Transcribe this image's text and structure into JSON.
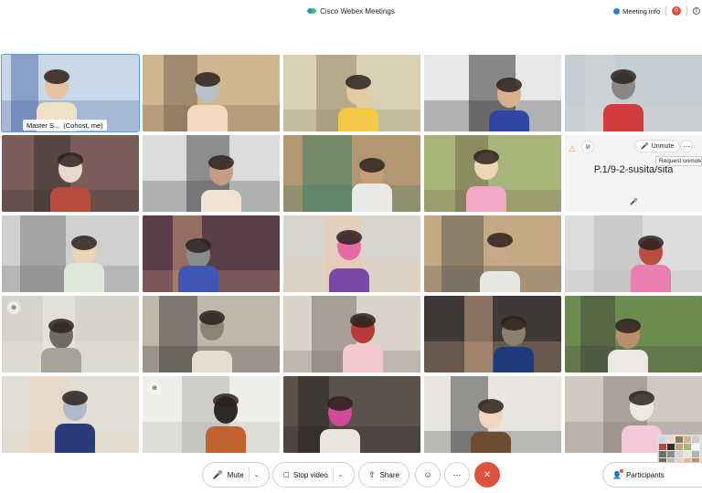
{
  "titlebar": {
    "app_title": "Cisco Webex Meetings",
    "meeting_info_label": "Meeting info",
    "notification_count": "0"
  },
  "tiles": [
    {
      "name": "Master S...",
      "role": "(Cohost, me)",
      "colors": [
        "#c9d8e6",
        "#f0e2c8",
        "#3b5aa0",
        "#e7c3a2"
      ]
    },
    {
      "colors": [
        "#cdb690",
        "#f4d9bf",
        "#6b5740",
        "#b7c1c7"
      ]
    },
    {
      "colors": [
        "#d9d0b4",
        "#f3c844",
        "#8c7a5a",
        "#e8c9a6"
      ]
    },
    {
      "colors": [
        "#e7e7e7",
        "#2f46a7",
        "#111111",
        "#d9b08c"
      ]
    },
    {
      "colors": [
        "#c4cdd2",
        "#d23c3c",
        "#d8d8d8",
        "#888888"
      ]
    },
    {
      "colors": [
        "#7a5d59",
        "#b84b3e",
        "#2b2b2b",
        "#e7d8cc"
      ]
    },
    {
      "colors": [
        "#d9dcd9",
        "#f1e2d4",
        "#2f2f2f",
        "#c49d86"
      ]
    },
    {
      "colors": [
        "#b39770",
        "#e9e8e4",
        "#2a7a63",
        "#c4a079"
      ]
    },
    {
      "colors": [
        "#a7b47a",
        "#f1a8c4",
        "#6e5a43",
        "#f0d6b9"
      ]
    },
    {
      "video_off": true,
      "unmute_label": "Unmute",
      "center_name": "P.1/9-2-susita/sita"
    },
    {
      "colors": [
        "#cfcfcf",
        "#dfe8d8",
        "#6d6d6d",
        "#e9d3b9"
      ]
    },
    {
      "colors": [
        "#5a3e4a",
        "#3f56b2",
        "#e1a77f",
        "#8c8d8b"
      ]
    },
    {
      "colors": [
        "#d8d5cf",
        "#7b4aa8",
        "#f0c8a8",
        "#e86aa2"
      ]
    },
    {
      "colors": [
        "#c3a883",
        "#e8e6e2",
        "#4c4c4c",
        "#c9a88b"
      ]
    },
    {
      "colors": [
        "#dcdcdc",
        "#e97fb0",
        "#b2b4b4",
        "#b84d40"
      ]
    },
    {
      "colors": [
        "#d7d3cd",
        "#a8a39a",
        "#f1efea",
        "#6f6a64"
      ],
      "badge": "⊕"
    },
    {
      "colors": [
        "#bfb8a9",
        "#e4ded1",
        "#2f2d2b",
        "#8b8376"
      ]
    },
    {
      "colors": [
        "#d9d3c8",
        "#f3c9cf",
        "#6a6058",
        "#b93a3a"
      ]
    },
    {
      "colors": [
        "#3f3a38",
        "#1f3a7a",
        "#e5b895",
        "#8d7f6e"
      ]
    },
    {
      "colors": [
        "#6c8d4f",
        "#ece9e4",
        "#3a3a3a",
        "#b98f6c"
      ]
    },
    {
      "colors": [
        "#e1ded7",
        "#2a3a7a",
        "#f0d2b8",
        "#b0b9c7"
      ]
    },
    {
      "colors": [
        "#efeeea",
        "#c1612d",
        "#a9a7a3",
        "#2a2a2a"
      ],
      "badge": "⊕"
    },
    {
      "colors": [
        "#5b524c",
        "#e9e5de",
        "#1d1b1a",
        "#d04a9b"
      ]
    },
    {
      "colors": [
        "#e9e6e1",
        "#6d4c2f",
        "#2a2a2a",
        "#f1d6bd"
      ]
    },
    {
      "colors": [
        "#cfc9c0",
        "#f6c9d8",
        "#7a746c",
        "#ece9e4"
      ]
    }
  ],
  "tooltip": "Request unmute",
  "controls": {
    "mute_label": "Mute",
    "stop_video_label": "Stop video",
    "share_label": "Share",
    "participants_label": "Participants"
  },
  "colors": {
    "accent": "#4aa3ff",
    "leave": "#e2503f",
    "mic_on": "#17a34a"
  }
}
